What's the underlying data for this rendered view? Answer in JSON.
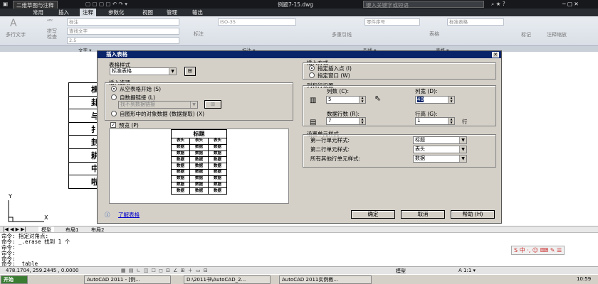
{
  "titlebar": {
    "workspace": "二维草图与注释",
    "doc_title": "例题7-15.dwg",
    "search_placeholder": "键入关键字或短语"
  },
  "menubar": {
    "tabs": [
      "常用",
      "插入",
      "注释",
      "参数化",
      "视图",
      "管理",
      "输出"
    ],
    "active": "注释"
  },
  "ribbon": {
    "multiline_text": "多行文字",
    "spell_check": "拼写\n检查",
    "text_style": "标注",
    "find_text": "查找文字",
    "text_height": "2.5",
    "dim": "标注",
    "dim_style": "ISO-35",
    "multileader": "多重引线",
    "leader_style": "零件序号",
    "table": "表格",
    "table_style": "标准表格",
    "markup": "标记",
    "annotation_scale": "注释缩放",
    "panel_labels": [
      "文字 ▾",
      "标注 ▾",
      "引线 ▾",
      "表格 ▾"
    ]
  },
  "drawing": {
    "table_chars": [
      "楫",
      "卦",
      "与",
      "扌",
      "刲",
      "耕",
      "中",
      "啦"
    ],
    "ucs_y": "Y",
    "ucs_x": "X"
  },
  "dialog": {
    "title": "插入表格",
    "table_style_label": "表格样式",
    "table_style_value": "标准表格",
    "insert_options_label": "插入选项",
    "opt_empty": "从空表格开始 (S)",
    "opt_link": "自数据链接 (L)",
    "link_value": "找不到数据链接",
    "opt_extract": "自图形中的对象数据 (数据提取) (X)",
    "preview_label": "预览 (P)",
    "preview": {
      "title": "标题",
      "header": [
        "表头",
        "表头",
        "表头"
      ],
      "cell": "数据",
      "rows": 8
    },
    "learn_link": "了解表格",
    "insert_method_label": "插入方式",
    "opt_insert_point": "指定插入点 (I)",
    "opt_window": "指定窗口 (W)",
    "col_row_label": "列和行设置",
    "columns_label": "列数 (C):",
    "columns_value": "5",
    "col_width_label": "列宽 (D):",
    "col_width_value": "40",
    "data_rows_label": "数据行数 (R):",
    "data_rows_value": "7",
    "row_height_label": "行高 (G):",
    "row_height_value": "1",
    "row_unit": "行",
    "cell_style_label": "设置单元样式",
    "first_row_label": "第一行单元样式:",
    "first_row_value": "标题",
    "second_row_label": "第二行单元样式:",
    "second_row_value": "表头",
    "other_rows_label": "所有其他行单元样式:",
    "other_rows_value": "数据",
    "ok": "确定",
    "cancel": "取消",
    "help": "帮助 (H)"
  },
  "layout_tabs": [
    "模型",
    "布局1",
    "布局2"
  ],
  "command_lines": [
    "命令: 指定对角点:",
    "命令: _.erase 找到 1 个",
    "命令:",
    "命令:",
    "命令:",
    "命令: _table"
  ],
  "status": {
    "coords": "478.1704, 259.2445 , 0.0000",
    "model": "模型",
    "scale": "A 1:1 ▾"
  },
  "taskbar": {
    "start": "开始",
    "items": [
      "AutoCAD 2011 - [例...",
      "D:\\2011书\\AutoCAD_2...",
      "AutoCAD 2011实例教..."
    ],
    "time": "10:59"
  }
}
